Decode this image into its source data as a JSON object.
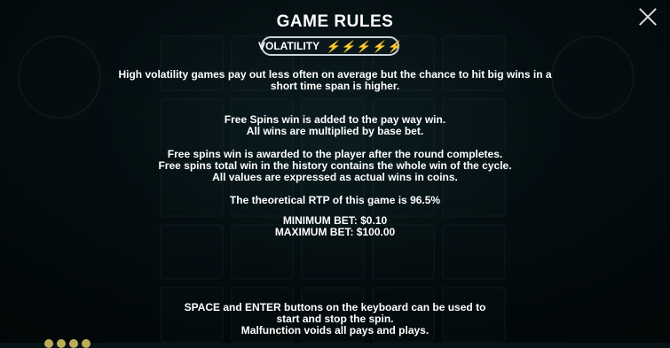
{
  "title": "GAME RULES",
  "volatility": {
    "label": "VOLATILITY",
    "level": 5,
    "max_level": 5,
    "icon": "lightning-bolt-icon",
    "color": "#f3c01a"
  },
  "rules": {
    "volatility_text_1": "High volatility games pay out less often on average but the chance to hit big wins in a",
    "volatility_text_2": "short time span is higher.",
    "free_spins_1": "Free Spins win is added to the pay way win.",
    "free_spins_2": "All wins are multiplied by base bet.",
    "free_spins_3": "Free spins win is awarded to the player after the round completes.",
    "free_spins_4": "Free spins total win in the history contains the whole win of the cycle.",
    "free_spins_5": "All values are expressed as actual wins in coins.",
    "rtp": "The theoretical RTP of this game is 96.5%",
    "min_bet": "MINIMUM BET: $0.10",
    "max_bet": "MAXIMUM BET: $100.00"
  },
  "footer": {
    "line_1": "SPACE and ENTER buttons on the keyboard can be used to",
    "line_2": "start and stop the spin.",
    "line_3": "Malfunction voids all pays and plays."
  },
  "close_icon": "close-icon"
}
